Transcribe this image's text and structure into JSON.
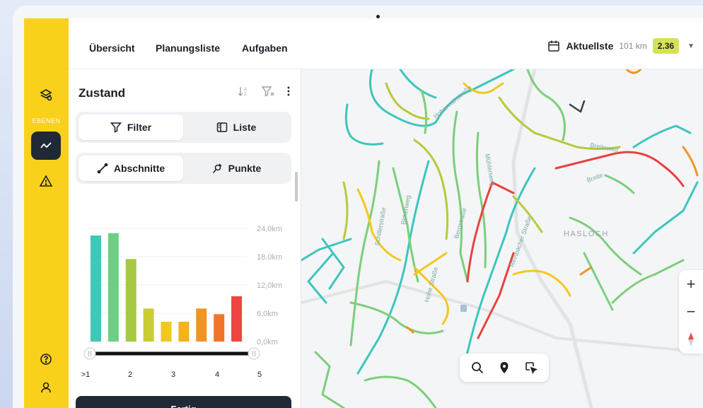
{
  "nav": {
    "items": [
      {
        "label": "Übersicht"
      },
      {
        "label": "Planungsliste"
      },
      {
        "label": "Aufgaben"
      }
    ]
  },
  "topright": {
    "label": "Aktuellste",
    "distance": "101 km",
    "score": "2.36",
    "score_color": "#d4e157"
  },
  "rail": {
    "section_label": "EBENEN",
    "icons": [
      "layers-icon",
      "trend-icon",
      "warning-icon",
      "help-icon",
      "user-icon"
    ]
  },
  "panel": {
    "title": "Zustand",
    "view_toggle": {
      "filter_label": "Filter",
      "list_label": "Liste",
      "selected": "Filter"
    },
    "type_toggle": {
      "sections_label": "Abschnitte",
      "points_label": "Punkte",
      "selected": "Abschnitte"
    },
    "done_label": "Fertig"
  },
  "chart_data": {
    "type": "bar",
    "categories": [
      ">1",
      "",
      "2",
      "",
      "3",
      "",
      "4",
      "",
      "5"
    ],
    "values": [
      22.5,
      23.0,
      17.5,
      7.0,
      4.2,
      4.2,
      7.0,
      5.8,
      9.6
    ],
    "bar_colors": [
      "#3fc8b6",
      "#6ccf85",
      "#a6c842",
      "#c9cd33",
      "#f2c81f",
      "#f3b31c",
      "#f19425",
      "#f07527",
      "#ee4540"
    ],
    "y_ticks": [
      "24,0km",
      "18,0km",
      "12,0km",
      "6,0km",
      "0,0km"
    ],
    "y_tick_values": [
      24,
      18,
      12,
      6,
      0
    ],
    "ylim": [
      0,
      24
    ],
    "x_tick_labels": [
      ">1",
      "2",
      "3",
      "4",
      "5"
    ],
    "range_slider": {
      "min": ">1",
      "max": "5"
    },
    "grid": true
  },
  "map": {
    "town_label": "HASLOCH",
    "street_labels": [
      "Hohenrainstraße",
      "Bergstraße",
      "Schillerstraße",
      "Birkenweg",
      "Mühlenweg",
      "Hohe Straße",
      "Reinbacher Straße",
      "Breiteweg",
      "Breite"
    ],
    "zoom_in": "+",
    "zoom_out": "−",
    "tools": [
      "search-icon",
      "pin-icon",
      "select-area-icon"
    ]
  }
}
